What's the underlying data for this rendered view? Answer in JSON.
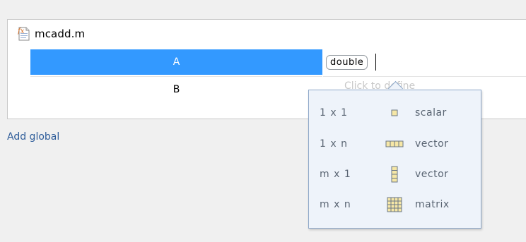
{
  "file": {
    "name": "mcadd.m",
    "icon": "function-file-icon"
  },
  "inputs": [
    {
      "name": "A",
      "type": "double",
      "selected": true
    },
    {
      "name": "B",
      "type_placeholder": "Click to define"
    }
  ],
  "add_global_label": "Add global",
  "size_options": [
    {
      "dims": "1 x 1",
      "shape_icon": "scalar-icon",
      "kind": "scalar"
    },
    {
      "dims": "1 x n",
      "shape_icon": "row-vector-icon",
      "kind": "vector"
    },
    {
      "dims": "m x 1",
      "shape_icon": "column-vector-icon",
      "kind": "vector"
    },
    {
      "dims": "m x n",
      "shape_icon": "matrix-icon",
      "kind": "matrix"
    }
  ],
  "colors": {
    "selection": "#3399ff",
    "link": "#2f5d9a",
    "popup_bg": "#eef3fa",
    "popup_border": "#8ea8c9",
    "icon_yellow": "#f6e7a6"
  }
}
